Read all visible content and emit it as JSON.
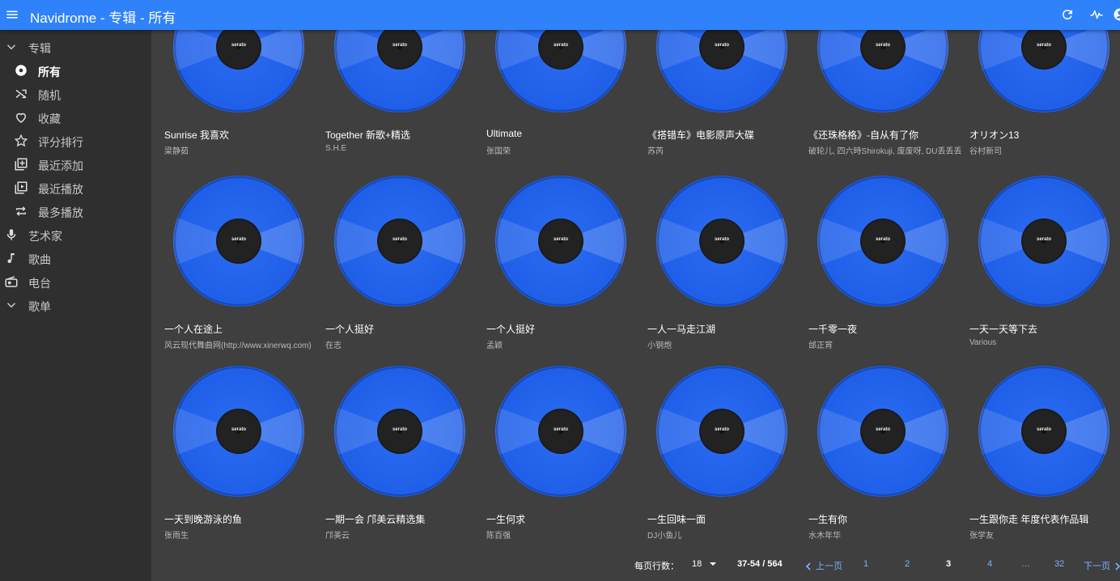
{
  "app": {
    "title": "Navidrome - 专辑 - 所有",
    "header_actions": [
      "refresh-icon",
      "activity-icon",
      "account-icon"
    ],
    "accent_color": "#2f82f9"
  },
  "sidebar": {
    "items": [
      {
        "label": "专辑",
        "icon": "chevron-down-icon",
        "level": 0
      },
      {
        "label": "所有",
        "icon": "disc-icon",
        "level": 1,
        "active": true
      },
      {
        "label": "随机",
        "icon": "shuffle-icon",
        "level": 1
      },
      {
        "label": "收藏",
        "icon": "heart-icon",
        "level": 1
      },
      {
        "label": "评分排行",
        "icon": "star-icon",
        "level": 1
      },
      {
        "label": "最近添加",
        "icon": "library-add-icon",
        "level": 1
      },
      {
        "label": "最近播放",
        "icon": "video-library-icon",
        "level": 1
      },
      {
        "label": "最多播放",
        "icon": "repeat-icon",
        "level": 1
      },
      {
        "label": "艺术家",
        "icon": "mic-icon",
        "level": 0
      },
      {
        "label": "歌曲",
        "icon": "music-note-icon",
        "level": 0
      },
      {
        "label": "电台",
        "icon": "radio-icon",
        "level": 0
      },
      {
        "label": "歌单",
        "icon": "chevron-down-icon",
        "level": 0
      }
    ]
  },
  "albums": [
    {
      "title": "Sunrise 我喜欢",
      "artist": "梁静茹"
    },
    {
      "title": "Together 新歌+精选",
      "artist": "S.H.E"
    },
    {
      "title": "Ultimate",
      "artist": "张国荣"
    },
    {
      "title": "《搭错车》电影原声大碟",
      "artist": "苏芮"
    },
    {
      "title": "《还珠格格》-自从有了你",
      "artist": "破轮儿, 四六時Shirokuji, 废废呀, DU丢丢丢"
    },
    {
      "title": "オリオン13",
      "artist": "谷村新司"
    },
    {
      "title": "一个人在途上",
      "artist": "风云现代舞曲网(http://www.xinerwq.com)"
    },
    {
      "title": "一个人挺好",
      "artist": "在志"
    },
    {
      "title": "一个人挺好",
      "artist": "孟颖"
    },
    {
      "title": "一人一马走江湖",
      "artist": "小钢炮"
    },
    {
      "title": "一千零一夜",
      "artist": "邰正宵"
    },
    {
      "title": "一天一天等下去",
      "artist": "Various"
    },
    {
      "title": "一天到晚游泳的鱼",
      "artist": "张雨生"
    },
    {
      "title": "一期一会 邝美云精选集",
      "artist": "邝美云"
    },
    {
      "title": "一生何求",
      "artist": "陈百强"
    },
    {
      "title": "一生回味一面",
      "artist": "DJ小鱼儿"
    },
    {
      "title": "一生有你",
      "artist": "水木年华"
    },
    {
      "title": "一生跟你走 年度代表作品辑",
      "artist": "张学友"
    }
  ],
  "cover": {
    "label_text": "serato",
    "vinyl_color": "#1f5fe8"
  },
  "pagination": {
    "rows_per_page_label": "每页行数：",
    "rows_per_page_value": "18",
    "range": "37-54 / 564",
    "prev_label": "上一页",
    "next_label": "下一页",
    "pages": [
      "1",
      "2",
      "3",
      "4",
      "…",
      "32"
    ],
    "current_page": "3"
  }
}
